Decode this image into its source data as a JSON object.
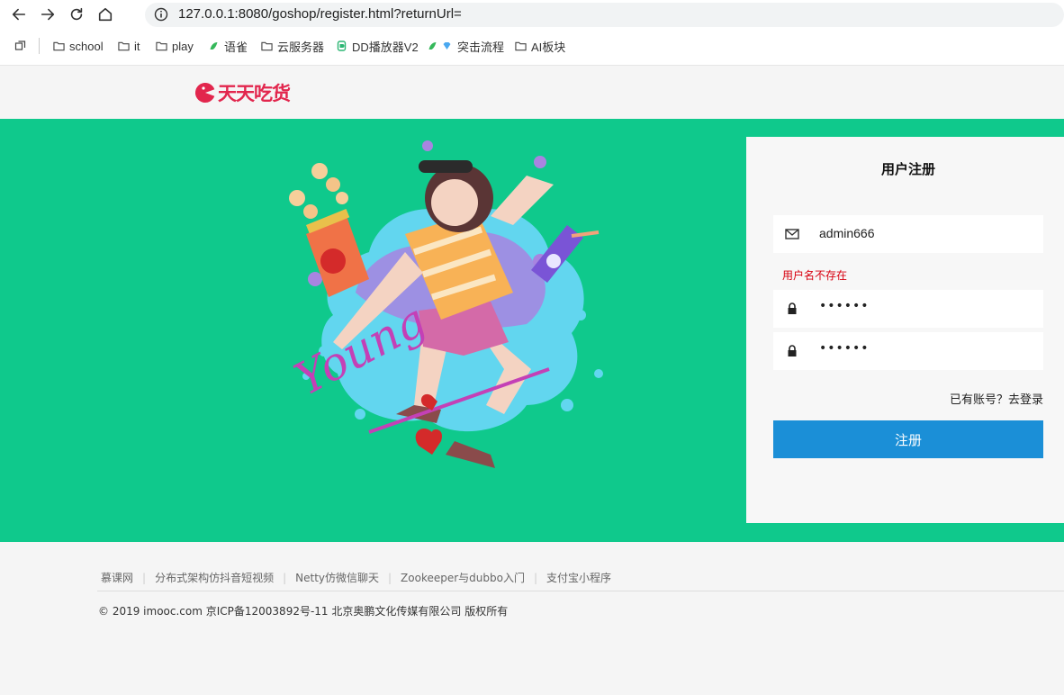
{
  "browser": {
    "url": "127.0.0.1:8080/goshop/register.html?returnUrl=",
    "bookmarks": [
      {
        "label": "school",
        "icon": "folder-icon"
      },
      {
        "label": "it",
        "icon": "folder-icon"
      },
      {
        "label": "play",
        "icon": "folder-icon"
      },
      {
        "label": "语雀",
        "icon": "yuque-icon"
      },
      {
        "label": "云服务器",
        "icon": "folder-icon"
      },
      {
        "label": "DD播放器V2",
        "icon": "dd-icon"
      },
      {
        "label": "突击流程",
        "icon": "yuque-icon"
      },
      {
        "label": "AI板块",
        "icon": "folder-icon"
      }
    ]
  },
  "header": {
    "logo_text": "天天吃货"
  },
  "banner": {
    "illustration_text": "Young",
    "colors": {
      "background": "#0fc98c"
    }
  },
  "register": {
    "title": "用户注册",
    "username_value": "admin666",
    "username_error": "用户名不存在",
    "password_mask": "••••••",
    "confirm_mask": "••••••",
    "login_link": "已有账号？去登录",
    "submit_label": "注册",
    "colors": {
      "submit": "#1b8fd7",
      "error": "#d7000f"
    }
  },
  "footer": {
    "links": [
      "慕课网",
      "分布式架构仿抖音短视频",
      "Netty仿微信聊天",
      "Zookeeper与dubbo入门",
      "支付宝小程序"
    ],
    "copyright": "© 2019 imooc.com 京ICP备12003892号-11 北京奥鹏文化传媒有限公司 版权所有"
  }
}
